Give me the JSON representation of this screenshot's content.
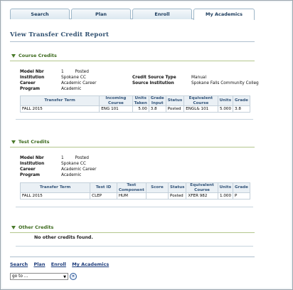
{
  "tabs": [
    {
      "label": "Search"
    },
    {
      "label": "Plan"
    },
    {
      "label": "Enroll"
    },
    {
      "label": "My Academics"
    }
  ],
  "page_title": "View Transfer Credit Report",
  "course_credits": {
    "header": "Course Credits",
    "model_nbr_label": "Model Nbr",
    "model_nbr": "1",
    "model_status": "Posted",
    "institution_label": "Institution",
    "institution": "Spokane CC",
    "career_label": "Career",
    "career": "Academic Career",
    "program_label": "Program",
    "program": "Academic",
    "credit_source_type_label": "Credit Source Type",
    "credit_source_type": "Manual",
    "source_institution_label": "Source Institution",
    "source_institution": "Spokane Falls Community Colleg",
    "columns": [
      "Transfer Term",
      "Incoming Course",
      "Units Taken",
      "Grade Input",
      "Status",
      "Equivalent Course",
      "Units",
      "Grade"
    ],
    "rows": [
      [
        "FALL 2015",
        "ENG 101",
        "5.00",
        "3.8",
        "Posted",
        "ENGL& 101",
        "5.000",
        "3.8"
      ]
    ]
  },
  "test_credits": {
    "header": "Test Credits",
    "model_nbr_label": "Model Nbr",
    "model_nbr": "1",
    "model_status": "Posted",
    "institution_label": "Institution",
    "institution": "Spokane CC",
    "career_label": "Career",
    "career": "Academic Career",
    "program_label": "Program",
    "program": "Academic",
    "columns": [
      "Transfer Term",
      "Test ID",
      "Test Component",
      "Score",
      "Status",
      "Equivalent Course",
      "Units",
      "Grade"
    ],
    "rows": [
      [
        "FALL 2015",
        "CLEP",
        "HUM",
        "",
        "Posted",
        "XFER  982",
        "1.000",
        "P"
      ]
    ]
  },
  "other_credits": {
    "header": "Other Credits",
    "message": "No other credits found."
  },
  "footer": {
    "links": [
      "Search",
      "Plan",
      "Enroll",
      "My Academics"
    ],
    "goto_value": "go to ...",
    "go_icon": "double-chevron-right-icon"
  }
}
